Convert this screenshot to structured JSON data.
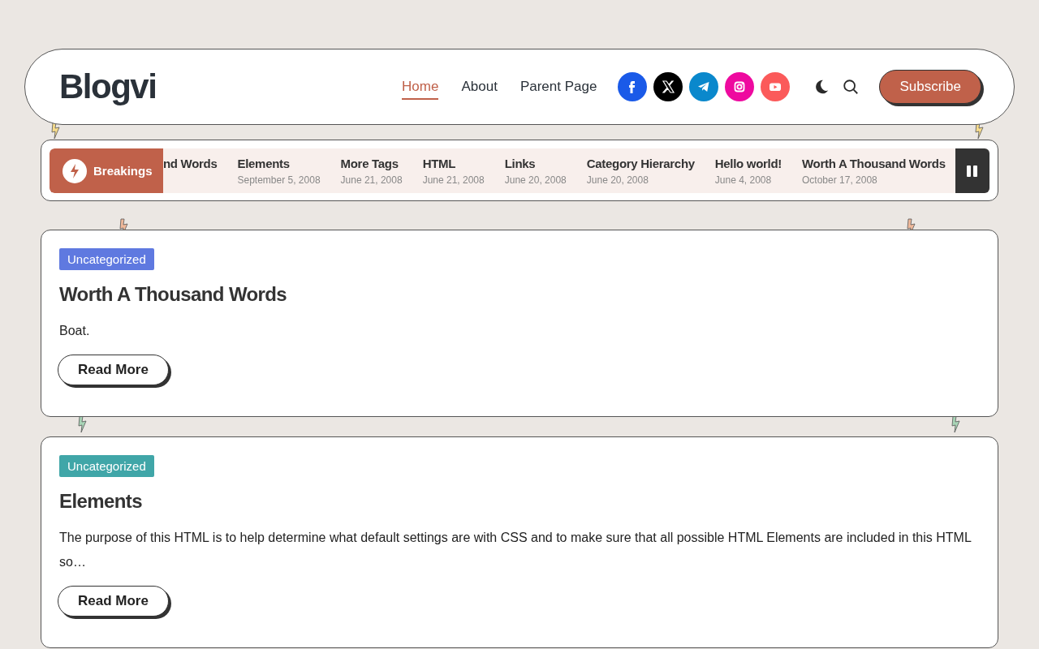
{
  "header": {
    "logo": "Blogvi",
    "nav": [
      {
        "label": "Home",
        "selected": true
      },
      {
        "label": "About",
        "selected": false
      },
      {
        "label": "Parent Page",
        "selected": false
      }
    ],
    "social": [
      {
        "kind": "facebook",
        "color": "#1a5ae8"
      },
      {
        "kind": "x",
        "color": "#000000"
      },
      {
        "kind": "telegram",
        "color": "#0a88cc"
      },
      {
        "kind": "instagram",
        "color": "#ee0a9f"
      },
      {
        "kind": "youtube",
        "color": "#fb5a5a"
      }
    ],
    "subscribe": "Subscribe"
  },
  "ticker": {
    "label": "Breakings",
    "items": [
      {
        "title": "nd Words"
      },
      {
        "title": "Elements",
        "date": "September 5, 2008"
      },
      {
        "title": "More Tags",
        "date": "June 21, 2008"
      },
      {
        "title": "HTML",
        "date": "June 21, 2008"
      },
      {
        "title": "Links",
        "date": "June 20, 2008"
      },
      {
        "title": "Category Hierarchy",
        "date": "June 20, 2008"
      },
      {
        "title": "Hello world!",
        "date": "June 4, 2008"
      },
      {
        "title": "Worth A Thousand Words",
        "date": "October 17, 2008"
      }
    ]
  },
  "posts": [
    {
      "category": "Uncategorized",
      "color": "#5f79e0",
      "title": "Worth A Thousand Words",
      "excerpt": "Boat.",
      "button": "Read More"
    },
    {
      "category": "Uncategorized",
      "color": "#40a6a8",
      "title": "Elements",
      "excerpt": "The purpose of this HTML is to help determine what default settings are with CSS and to make sure that all possible HTML Elements are included in this HTML so…",
      "button": "Read More"
    }
  ]
}
